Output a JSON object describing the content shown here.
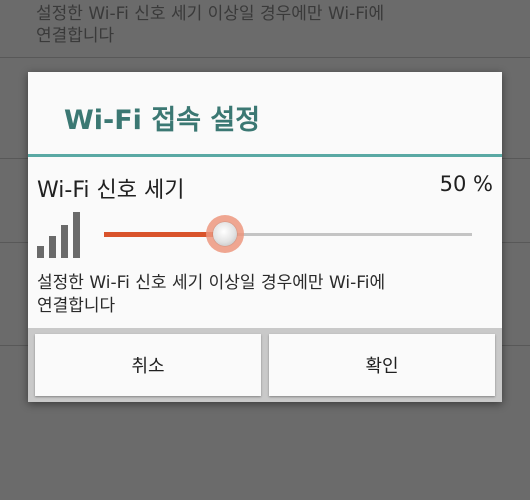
{
  "background": {
    "description_line1": "설정한 Wi-Fi 신호 세기 이상일 경우에만 Wi-Fi에",
    "description_line2": "연결합니다"
  },
  "dialog": {
    "title": "Wi-Fi 접속 설정",
    "signal_label": "Wi-Fi 신호 세기",
    "percent_text": "50 %",
    "slider_value_fraction": 0.33,
    "description_line1": "설정한 Wi-Fi 신호 세기 이상일 경우에만 Wi-Fi에",
    "description_line2": "연결합니다",
    "cancel_label": "취소",
    "ok_label": "확인"
  },
  "icons": {
    "signal": "signal-strength-icon"
  },
  "colors": {
    "accent_title": "#3b7873",
    "title_rule": "#5aa9a4",
    "slider_active": "#d9532b",
    "slider_thumb_halo": "#ec967e"
  }
}
